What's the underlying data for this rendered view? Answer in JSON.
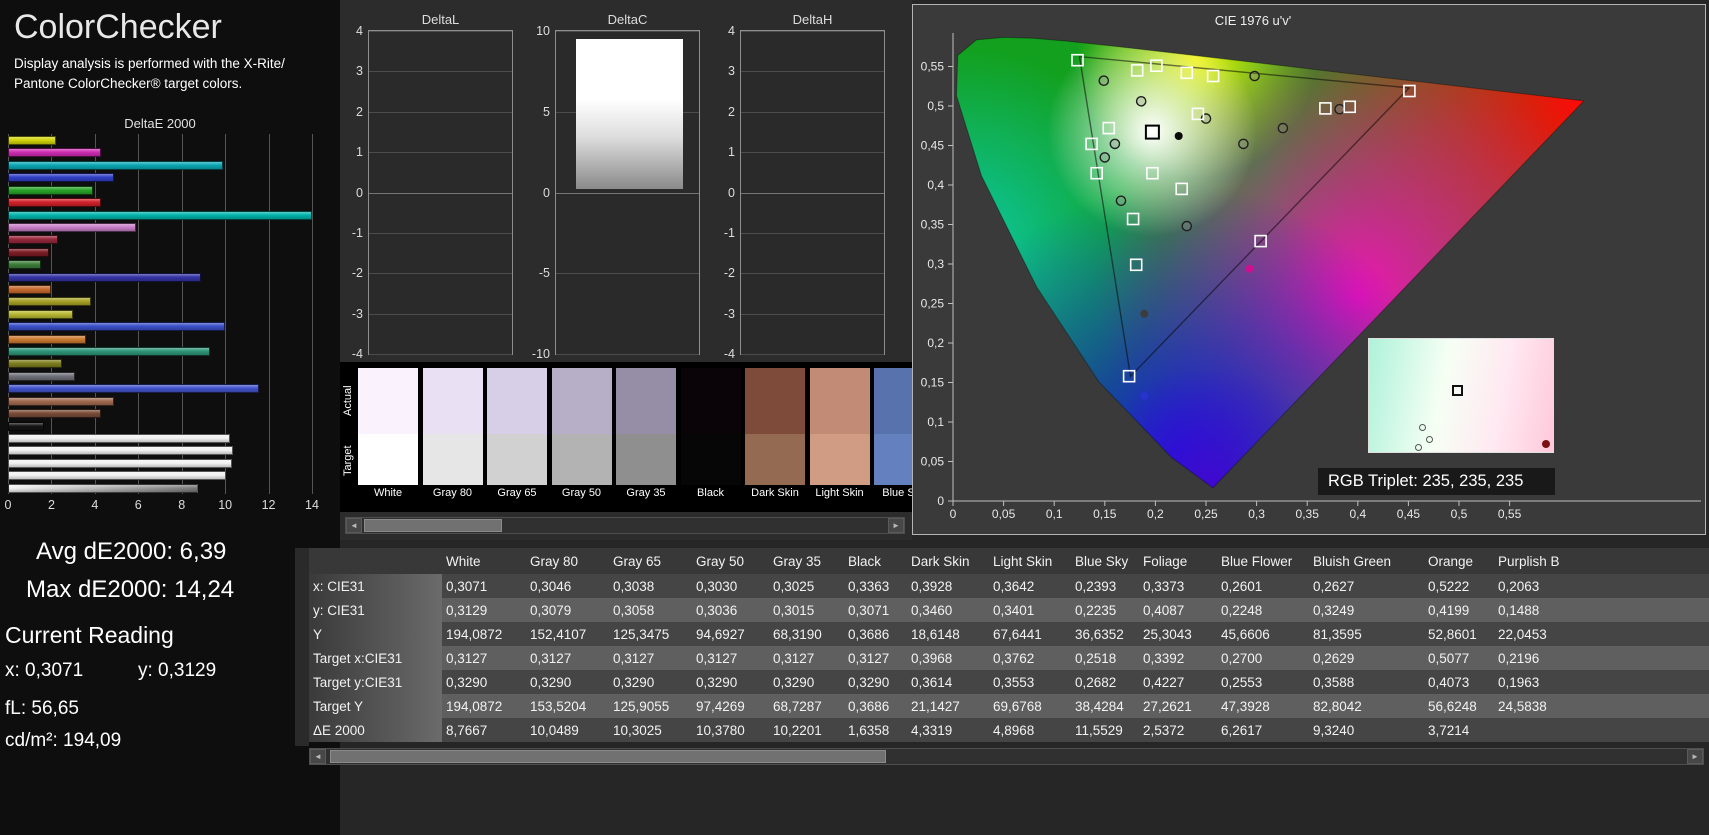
{
  "header": {
    "title": "ColorChecker",
    "subtitle_line1": "Display analysis is performed with the X-Rite/",
    "subtitle_line2": "Pantone ColorChecker® target colors."
  },
  "readings": {
    "avg": "Avg dE2000: 6,39",
    "max": "Max dE2000: 14,24",
    "current_label": "Current Reading",
    "x": "x: 0,3071",
    "y": "y: 0,3129",
    "fl": "fL: 56,65",
    "cdm2": "cd/m²: 194,09"
  },
  "icons": {
    "left_arrow": "◄",
    "right_arrow": "►"
  },
  "chart_data": [
    {
      "id": "deltae2000",
      "type": "bar",
      "orientation": "horizontal",
      "title": "DeltaE 2000",
      "xlabel": "",
      "ylabel": "",
      "xlim": [
        0,
        14
      ],
      "xticks": [
        0,
        2,
        4,
        6,
        8,
        10,
        12,
        14
      ],
      "bars": [
        {
          "v": 2.2,
          "c": "#d2d40a"
        },
        {
          "v": 4.3,
          "c": "#d02cb4"
        },
        {
          "v": 9.9,
          "c": "#0aa8b4"
        },
        {
          "v": 4.9,
          "c": "#3240c8"
        },
        {
          "v": 3.9,
          "c": "#28a428"
        },
        {
          "v": 4.3,
          "c": "#d22028"
        },
        {
          "v": 14.24,
          "c": "#00b4aa"
        },
        {
          "v": 5.9,
          "c": "#c87ec8"
        },
        {
          "v": 2.3,
          "c": "#96283c"
        },
        {
          "v": 1.9,
          "c": "#7c1c24"
        },
        {
          "v": 1.5,
          "c": "#3e7e3a"
        },
        {
          "v": 8.9,
          "c": "#3434a4"
        },
        {
          "v": 2.0,
          "c": "#c86a2e"
        },
        {
          "v": 3.8,
          "c": "#a8a226"
        },
        {
          "v": 3.0,
          "c": "#b8b832"
        },
        {
          "v": 10.0,
          "c": "#3a50c8"
        },
        {
          "v": 3.6,
          "c": "#cc7a30"
        },
        {
          "v": 9.3,
          "c": "#2e9678"
        },
        {
          "v": 2.5,
          "c": "#7e7e1e"
        },
        {
          "v": 3.1,
          "c": "#70707a"
        },
        {
          "v": 11.55,
          "c": "#4254cc"
        },
        {
          "v": 4.9,
          "c": "#a06a50"
        },
        {
          "v": 4.3,
          "c": "#7a4c38"
        },
        {
          "v": 1.64,
          "c": "#141414"
        },
        {
          "v": 10.22,
          "c": "#f2f2f2"
        },
        {
          "v": 10.38,
          "c": "#f2f2f2"
        },
        {
          "v": 10.3,
          "c": "#f2f2f2"
        },
        {
          "v": 10.05,
          "c": "#f2f2f2"
        },
        {
          "v": 8.77,
          "c": "#f4f4f4",
          "c2": "#787878"
        }
      ]
    },
    {
      "id": "deltaL",
      "type": "bar",
      "title": "DeltaL",
      "ylim": [
        -4,
        4
      ],
      "yticks": [
        4,
        3,
        2,
        1,
        0,
        -1,
        -2,
        -3,
        -4
      ],
      "values": []
    },
    {
      "id": "deltaC",
      "type": "bar",
      "title": "DeltaC",
      "ylim": [
        -10,
        10
      ],
      "yticks": [
        10,
        5,
        0,
        -5,
        -10
      ],
      "block": {
        "from": 0.2,
        "to": 9.5
      }
    },
    {
      "id": "deltaH",
      "type": "bar",
      "title": "DeltaH",
      "ylim": [
        -4,
        4
      ],
      "yticks": [
        4,
        3,
        2,
        1,
        0,
        -1,
        -2,
        -3,
        -4
      ],
      "values": []
    },
    {
      "id": "cie1976",
      "type": "scatter",
      "title": "CIE 1976 u'v'",
      "xlim": [
        0,
        0.62
      ],
      "ylim": [
        0,
        0.6
      ],
      "x_tick_labels": [
        "0",
        "0,05",
        "0,1",
        "0,15",
        "0,2",
        "0,25",
        "0,3",
        "0,35",
        "0,4",
        "0,45",
        "0,5",
        "0,55"
      ],
      "y_tick_labels": [
        "0",
        "0,05",
        "0,1",
        "0,15",
        "0,2",
        "0,25",
        "0,3",
        "0,35",
        "0,4",
        "0,45",
        "0,5",
        "0,55"
      ],
      "gamut_triangle": [
        [
          0.4507,
          0.5229
        ],
        [
          0.125,
          0.5625
        ],
        [
          0.1754,
          0.1579
        ]
      ],
      "white_point_square": [
        0.197,
        0.467
      ],
      "target_squares": [
        [
          0.123,
          0.558
        ],
        [
          0.182,
          0.545
        ],
        [
          0.201,
          0.551
        ],
        [
          0.231,
          0.542
        ],
        [
          0.257,
          0.538
        ],
        [
          0.451,
          0.519
        ],
        [
          0.368,
          0.497
        ],
        [
          0.392,
          0.499
        ],
        [
          0.242,
          0.49
        ],
        [
          0.154,
          0.472
        ],
        [
          0.137,
          0.452
        ],
        [
          0.142,
          0.415
        ],
        [
          0.197,
          0.415
        ],
        [
          0.226,
          0.395
        ],
        [
          0.178,
          0.357
        ],
        [
          0.304,
          0.329
        ],
        [
          0.181,
          0.299
        ],
        [
          0.174,
          0.158
        ]
      ],
      "measured_circles": [
        [
          0.149,
          0.532
        ],
        [
          0.186,
          0.506
        ],
        [
          0.298,
          0.538
        ],
        [
          0.25,
          0.484
        ],
        [
          0.326,
          0.472
        ],
        [
          0.382,
          0.496
        ],
        [
          0.15,
          0.435
        ],
        [
          0.16,
          0.452
        ],
        [
          0.166,
          0.38
        ],
        [
          0.231,
          0.348
        ],
        [
          0.287,
          0.452
        ]
      ],
      "dots": [
        {
          "u": 0.223,
          "v": 0.462,
          "color": "#0a0a0a"
        },
        {
          "u": 0.189,
          "v": 0.237,
          "color": "#3c3c3c"
        },
        {
          "u": 0.293,
          "v": 0.294,
          "color": "#cc1090"
        },
        {
          "u": 0.189,
          "v": 0.133,
          "color": "#2832cc"
        }
      ],
      "inset": {
        "u_range": [
          0.41,
          0.594
        ],
        "v_range": [
          0.061,
          0.206
        ],
        "square": {
          "x": 0.48,
          "y": 0.45
        },
        "circles": [
          {
            "x": 0.29,
            "y": 0.78
          },
          {
            "x": 0.33,
            "y": 0.88
          },
          {
            "x": 0.27,
            "y": 0.95
          }
        ],
        "dot": {
          "x": 0.95,
          "y": 0.92,
          "color": "#7a1212"
        }
      },
      "rgb_triplet_label": "RGB Triplet: 235, 235, 235"
    }
  ],
  "swatches": {
    "row_labels": [
      "Actual",
      "Target"
    ],
    "items": [
      {
        "name": "White",
        "actual": "#faf3fd",
        "target": "#ffffff"
      },
      {
        "name": "Gray 80",
        "actual": "#e9e1f3",
        "target": "#e6e6e6"
      },
      {
        "name": "Gray 65",
        "actual": "#d7cfe7",
        "target": "#d1d1d1"
      },
      {
        "name": "Gray 50",
        "actual": "#b7aec8",
        "target": "#b3b3b3"
      },
      {
        "name": "Gray 35",
        "actual": "#968da6",
        "target": "#8f8f8f"
      },
      {
        "name": "Black",
        "actual": "#0a0408",
        "target": "#060606"
      },
      {
        "name": "Dark Skin",
        "actual": "#7e4b3a",
        "target": "#956a52"
      },
      {
        "name": "Light Skin",
        "actual": "#c28b75",
        "target": "#d09c84"
      },
      {
        "name": "Blue Sky",
        "actual": "#5872ae",
        "target": "#6580be"
      }
    ]
  },
  "table": {
    "columns": [
      "",
      "White",
      "Gray 80",
      "Gray 65",
      "Gray 50",
      "Gray 35",
      "Black",
      "Dark Skin",
      "Light Skin",
      "Blue Sky",
      "Foliage",
      "Blue Flower",
      "Bluish Green",
      "Orange",
      "Purplish B"
    ],
    "rows": [
      {
        "label": "x: CIE31",
        "values": [
          "0,3071",
          "0,3046",
          "0,3038",
          "0,3030",
          "0,3025",
          "0,3363",
          "0,3928",
          "0,3642",
          "0,2393",
          "0,3373",
          "0,2601",
          "0,2627",
          "0,5222",
          "0,2063"
        ]
      },
      {
        "label": "y: CIE31",
        "values": [
          "0,3129",
          "0,3079",
          "0,3058",
          "0,3036",
          "0,3015",
          "0,3071",
          "0,3460",
          "0,3401",
          "0,2235",
          "0,4087",
          "0,2248",
          "0,3249",
          "0,4199",
          "0,1488"
        ]
      },
      {
        "label": "Y",
        "values": [
          "194,0872",
          "152,4107",
          "125,3475",
          "94,6927",
          "68,3190",
          "0,3686",
          "18,6148",
          "67,6441",
          "36,6352",
          "25,3043",
          "45,6606",
          "81,3595",
          "52,8601",
          "22,0453"
        ]
      },
      {
        "label": "Target x:CIE31",
        "values": [
          "0,3127",
          "0,3127",
          "0,3127",
          "0,3127",
          "0,3127",
          "0,3127",
          "0,3968",
          "0,3762",
          "0,2518",
          "0,3392",
          "0,2700",
          "0,2629",
          "0,5077",
          "0,2196"
        ]
      },
      {
        "label": "Target y:CIE31",
        "values": [
          "0,3290",
          "0,3290",
          "0,3290",
          "0,3290",
          "0,3290",
          "0,3290",
          "0,3614",
          "0,3553",
          "0,2682",
          "0,4227",
          "0,2553",
          "0,3588",
          "0,4073",
          "0,1963"
        ]
      },
      {
        "label": "Target Y",
        "values": [
          "194,0872",
          "153,5204",
          "125,9055",
          "97,4269",
          "68,7287",
          "0,3686",
          "21,1427",
          "69,6768",
          "38,4284",
          "27,2621",
          "47,3928",
          "82,8042",
          "56,6248",
          "24,5838"
        ]
      },
      {
        "label": "ΔE 2000",
        "values": [
          "8,7667",
          "10,0489",
          "10,3025",
          "10,3780",
          "10,2201",
          "1,6358",
          "4,3319",
          "4,8968",
          "11,5529",
          "2,5372",
          "6,2617",
          "9,3240",
          "3,7214",
          ""
        ]
      }
    ]
  }
}
